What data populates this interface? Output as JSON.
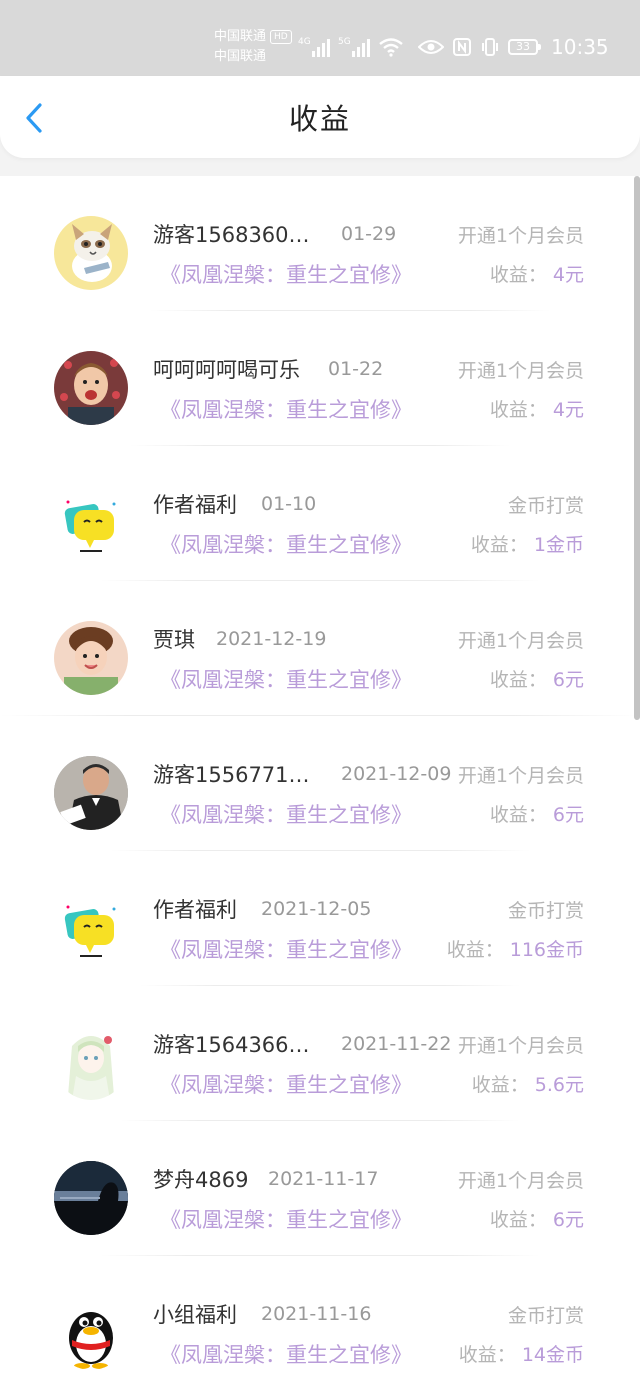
{
  "status_bar": {
    "carrier_1": "中国联通",
    "carrier_1_badge": "HD",
    "carrier_2": "中国联通",
    "net_1": "4G",
    "net_2": "5G",
    "battery": "33",
    "time": "10:35"
  },
  "header": {
    "title": "收益"
  },
  "items": [
    {
      "name": "游客1568360…",
      "date": "01-29",
      "type": "开通1个月会员",
      "book": "《凤凰涅槃：重生之宜修》",
      "income_label": "收益：",
      "amount": "4元",
      "avatar": "cat-avatar"
    },
    {
      "name": "呵呵呵呵喝可乐",
      "date": "01-22",
      "type": "开通1个月会员",
      "book": "《凤凰涅槃：重生之宜修》",
      "income_label": "收益：",
      "amount": "4元",
      "avatar": "kid-avatar"
    },
    {
      "name": "作者福利",
      "date": "01-10",
      "type": "金币打赏",
      "book": "《凤凰涅槃：重生之宜修》",
      "income_label": "收益：",
      "amount": "1金币",
      "avatar": "chat-bubble-avatar"
    },
    {
      "name": "贾琪",
      "date": "2021-12-19",
      "type": "开通1个月会员",
      "book": "《凤凰涅槃：重生之宜修》",
      "income_label": "收益：",
      "amount": "6元",
      "avatar": "girl-avatar"
    },
    {
      "name": "游客1556771…",
      "date": "2021-12-09",
      "type": "开通1个月会员",
      "book": "《凤凰涅槃：重生之宜修》",
      "income_label": "收益：",
      "amount": "6元",
      "avatar": "man-avatar"
    },
    {
      "name": "作者福利",
      "date": "2021-12-05",
      "type": "金币打赏",
      "book": "《凤凰涅槃：重生之宜修》",
      "income_label": "收益：",
      "amount": "116金币",
      "avatar": "chat-bubble-avatar"
    },
    {
      "name": "游客1564366…",
      "date": "2021-11-22",
      "type": "开通1个月会员",
      "book": "《凤凰涅槃：重生之宜修》",
      "income_label": "收益：",
      "amount": "5.6元",
      "avatar": "anime-avatar"
    },
    {
      "name": "梦舟4869",
      "date": "2021-11-17",
      "type": "开通1个月会员",
      "book": "《凤凰涅槃：重生之宜修》",
      "income_label": "收益：",
      "amount": "6元",
      "avatar": "sunset-avatar"
    },
    {
      "name": "小组福利",
      "date": "2021-11-16",
      "type": "金币打赏",
      "book": "《凤凰涅槃：重生之宜修》",
      "income_label": "收益：",
      "amount": "14金币",
      "avatar": "penguin-avatar"
    }
  ],
  "colors": {
    "accent": "#b99cd9",
    "back": "#2b9af3",
    "muted": "#b5b5b5"
  }
}
